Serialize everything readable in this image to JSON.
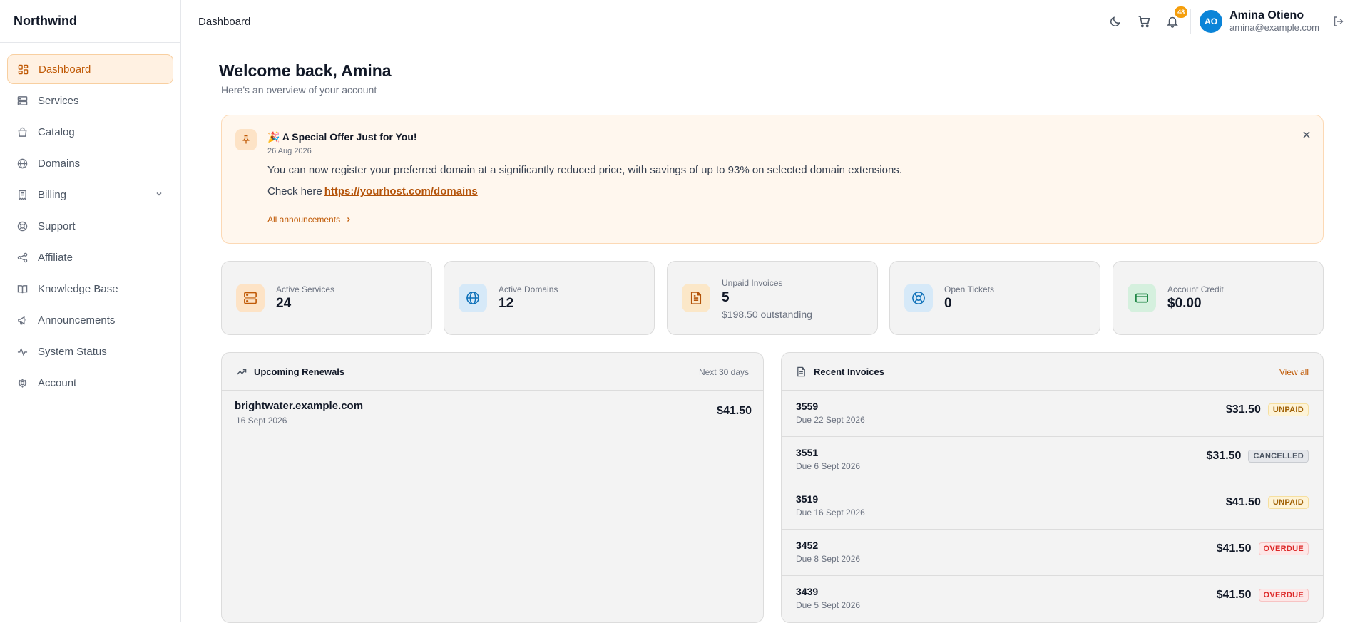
{
  "app": {
    "brand": "Northwind"
  },
  "sidebar": {
    "items": [
      {
        "label": "Dashboard",
        "icon": "grid-icon",
        "active": true
      },
      {
        "label": "Services",
        "icon": "server-icon"
      },
      {
        "label": "Catalog",
        "icon": "bag-icon"
      },
      {
        "label": "Domains",
        "icon": "globe-icon"
      },
      {
        "label": "Billing",
        "icon": "receipt-icon",
        "has_submenu": true
      },
      {
        "label": "Support",
        "icon": "lifebuoy-icon"
      },
      {
        "label": "Affiliate",
        "icon": "share-icon"
      },
      {
        "label": "Knowledge Base",
        "icon": "book-icon"
      },
      {
        "label": "Announcements",
        "icon": "megaphone-icon"
      },
      {
        "label": "System Status",
        "icon": "activity-icon"
      },
      {
        "label": "Account",
        "icon": "gear-icon"
      }
    ]
  },
  "header": {
    "title": "Dashboard",
    "notifications_count": "48",
    "user": {
      "initials": "AO",
      "name": "Amina Otieno",
      "email": "amina@example.com"
    }
  },
  "welcome": {
    "title": "Welcome back, Amina",
    "subtitle": "Here's an overview of your account"
  },
  "announcement": {
    "title": "🎉 A Special Offer Just for You!",
    "date": "26 Aug 2026",
    "body": "You can now register your preferred domain at a significantly reduced price, with savings of up to 93% on selected domain extensions.",
    "check_prefix": "Check here",
    "link": "https://yourhost.com/domains",
    "all_link": "All announcements"
  },
  "stats": [
    {
      "label": "Active Services",
      "value": "24",
      "icon": "server-icon",
      "color": "#c05a06",
      "bg": "#fde3c6"
    },
    {
      "label": "Active Domains",
      "value": "12",
      "icon": "globe-icon",
      "color": "#0b6fb8",
      "bg": "#d6e9f8"
    },
    {
      "label": "Unpaid Invoices",
      "value": "5",
      "sub": "$198.50 outstanding",
      "icon": "invoice-icon",
      "color": "#b45309",
      "bg": "#fbe7c8"
    },
    {
      "label": "Open Tickets",
      "value": "0",
      "icon": "lifebuoy-icon",
      "color": "#0b6fb8",
      "bg": "#d6e9f8"
    },
    {
      "label": "Account Credit",
      "value": "$0.00",
      "icon": "credit-card-icon",
      "color": "#15803d",
      "bg": "#d5f0de"
    }
  ],
  "renewals": {
    "title": "Upcoming Renewals",
    "range": "Next 30 days",
    "items": [
      {
        "domain": "brightwater.example.com",
        "date": "16 Sept 2026",
        "amount": "$41.50"
      }
    ]
  },
  "invoices": {
    "title": "Recent Invoices",
    "view_all": "View all",
    "items": [
      {
        "number": "3559",
        "due": "Due 22 Sept 2026",
        "amount": "$31.50",
        "status": "UNPAID"
      },
      {
        "number": "3551",
        "due": "Due 6 Sept 2026",
        "amount": "$31.50",
        "status": "CANCELLED"
      },
      {
        "number": "3519",
        "due": "Due 16 Sept 2026",
        "amount": "$41.50",
        "status": "UNPAID"
      },
      {
        "number": "3452",
        "due": "Due 8 Sept 2026",
        "amount": "$41.50",
        "status": "OVERDUE"
      },
      {
        "number": "3439",
        "due": "Due 5 Sept 2026",
        "amount": "$41.50",
        "status": "OVERDUE"
      }
    ]
  }
}
